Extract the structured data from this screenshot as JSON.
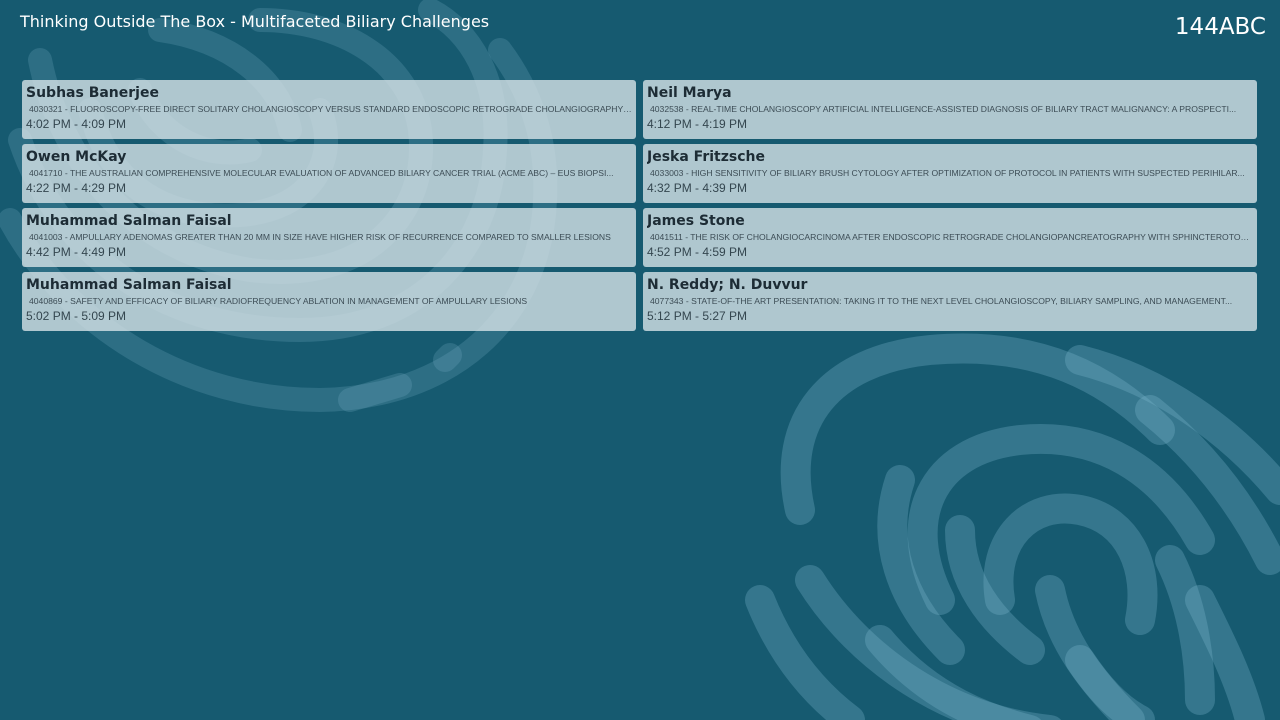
{
  "header": {
    "session_title": "Thinking Outside The Box - Multifaceted Biliary Challenges",
    "room": "144ABC"
  },
  "theme": {
    "background": "#165a70",
    "card_background": "#d6e2e7",
    "swirl_color": "#7fb8cf"
  },
  "presentations": [
    {
      "speaker": "Subhas Banerjee",
      "abstract": "4030321 - FLUOROSCOPY-FREE DIRECT SOLITARY CHOLANGIOSCOPY VERSUS STANDARD ENDOSCOPIC RETROGRADE CHOLANGIOGRAPHY F...",
      "time": "4:02 PM - 4:09 PM"
    },
    {
      "speaker": "Neil Marya",
      "abstract": "4032538 - REAL-TIME CHOLANGIOSCOPY ARTIFICIAL INTELLIGENCE-ASSISTED DIAGNOSIS OF BILIARY TRACT MALIGNANCY: A PROSPECTI...",
      "time": "4:12 PM - 4:19 PM"
    },
    {
      "speaker": "Owen McKay",
      "abstract": "4041710 - THE AUSTRALIAN COMPREHENSIVE MOLECULAR EVALUATION OF ADVANCED BILIARY CANCER TRIAL (ACME ABC) – EUS BIOPSI...",
      "time": "4:22 PM - 4:29 PM"
    },
    {
      "speaker": "Jeska Fritzsche",
      "abstract": "4033003 - HIGH SENSITIVITY OF BILIARY BRUSH CYTOLOGY AFTER OPTIMIZATION OF PROTOCOL IN PATIENTS WITH SUSPECTED PERIHILAR...",
      "time": "4:32 PM - 4:39 PM"
    },
    {
      "speaker": "Muhammad Salman Faisal",
      "abstract": "4041003 - AMPULLARY ADENOMAS GREATER THAN 20 MM IN SIZE HAVE HIGHER RISK OF RECURRENCE COMPARED TO SMALLER LESIONS",
      "time": "4:42 PM - 4:49 PM"
    },
    {
      "speaker": "James Stone",
      "abstract": "4041511 - THE RISK OF CHOLANGIOCARCINOMA AFTER ENDOSCOPIC RETROGRADE CHOLANGIOPANCREATOGRAPHY WITH SPHINCTEROTOM...",
      "time": "4:52 PM - 4:59 PM"
    },
    {
      "speaker": "Muhammad Salman Faisal",
      "abstract": "4040869 - SAFETY AND EFFICACY OF BILIARY RADIOFREQUENCY ABLATION IN MANAGEMENT OF AMPULLARY LESIONS",
      "time": "5:02 PM - 5:09 PM"
    },
    {
      "speaker": "N. Reddy; N. Duvvur",
      "abstract": "4077343 - STATE-OF-THE ART PRESENTATION: TAKING IT TO THE NEXT LEVEL CHOLANGIOSCOPY, BILIARY SAMPLING, AND MANAGEMENT...",
      "time": "5:12 PM - 5:27 PM"
    }
  ]
}
